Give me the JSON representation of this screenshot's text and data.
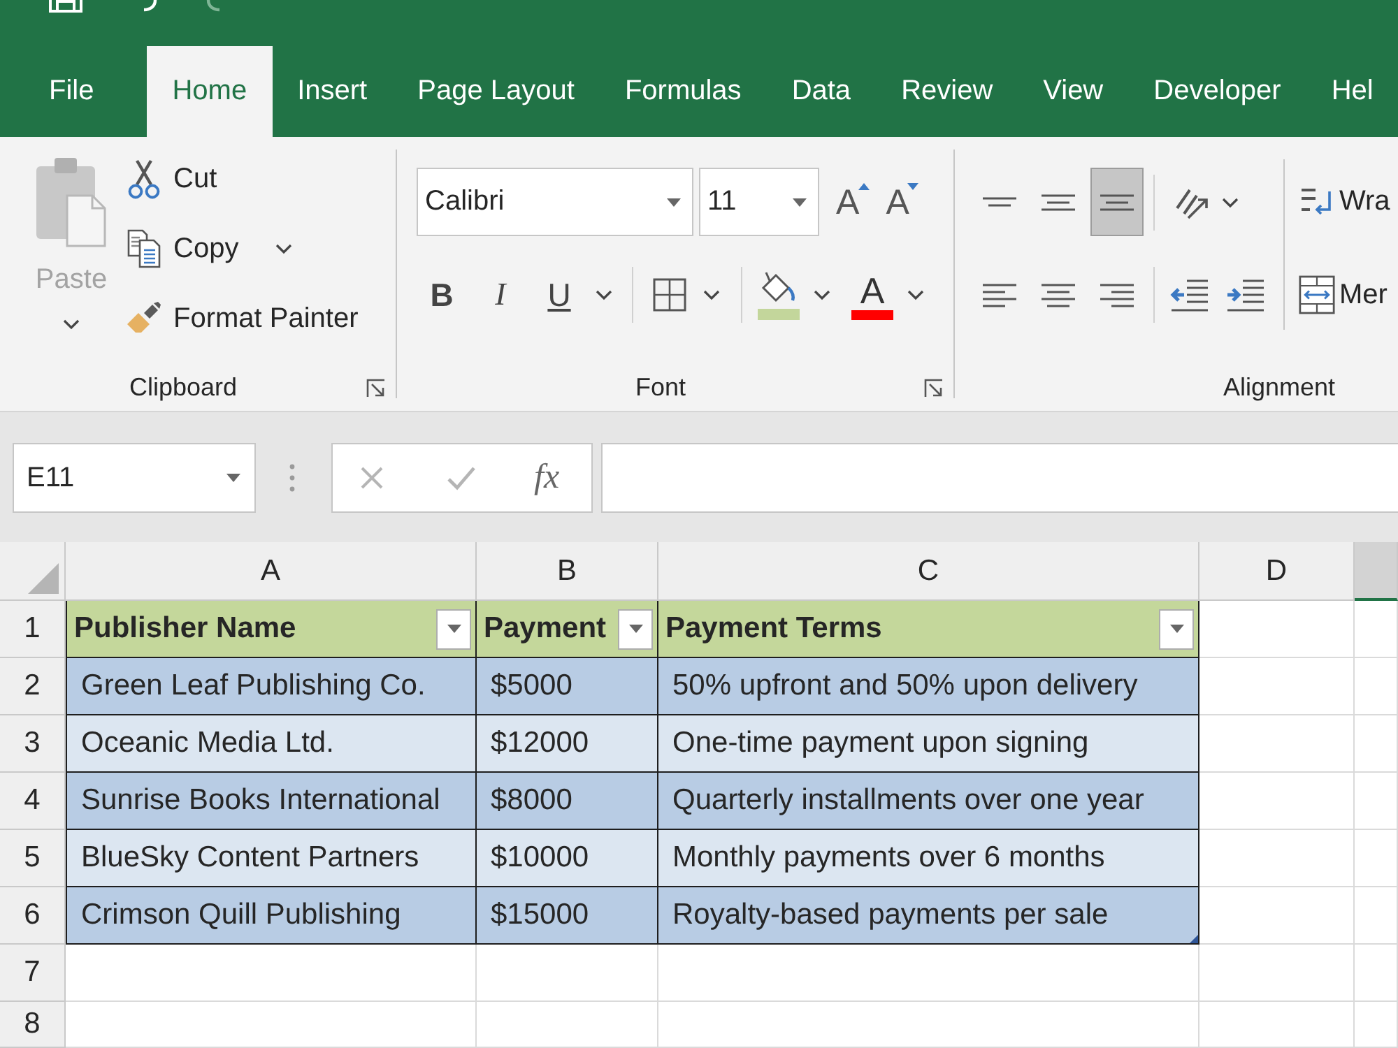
{
  "ribbon_tabs": [
    {
      "label": "File",
      "selected": false
    },
    {
      "label": "Home",
      "selected": true
    },
    {
      "label": "Insert",
      "selected": false
    },
    {
      "label": "Page Layout",
      "selected": false
    },
    {
      "label": "Formulas",
      "selected": false
    },
    {
      "label": "Data",
      "selected": false
    },
    {
      "label": "Review",
      "selected": false
    },
    {
      "label": "View",
      "selected": false
    },
    {
      "label": "Developer",
      "selected": false
    },
    {
      "label": "Hel",
      "selected": false
    }
  ],
  "clipboard": {
    "paste": {
      "label": "Paste",
      "disabled": true
    },
    "commands": [
      {
        "kind": "cut",
        "label": "Cut"
      },
      {
        "kind": "copy",
        "label": "Copy"
      },
      {
        "kind": "format_painter",
        "label": "Format Painter"
      }
    ],
    "group_label": "Clipboard"
  },
  "font": {
    "font_name": "Calibri",
    "font_size": "11",
    "grow_font": "A",
    "shrink_font": "A",
    "styles": [
      {
        "kind": "bold",
        "label": "B"
      },
      {
        "kind": "italic",
        "label": "I"
      },
      {
        "kind": "underline",
        "label": "U"
      }
    ],
    "font_color": "A",
    "group_label": "Font"
  },
  "alignment": {
    "vertical": [
      {
        "kind": "top",
        "selected": false
      },
      {
        "kind": "middle",
        "selected": false
      },
      {
        "kind": "bottom",
        "selected": true
      }
    ],
    "horizontal": [
      {
        "kind": "left",
        "selected": false
      },
      {
        "kind": "center",
        "selected": false
      },
      {
        "kind": "right",
        "selected": false
      }
    ],
    "wrap_text": "Wra",
    "merge": "Mer",
    "group_label": "Alignment"
  },
  "formula_bar": {
    "name_box": "E11",
    "function_button": "fx"
  },
  "sheet": {
    "columns": [
      {
        "label": "A",
        "selected": false
      },
      {
        "label": "B",
        "selected": false
      },
      {
        "label": "C",
        "selected": false
      },
      {
        "label": "D",
        "selected": false
      },
      {
        "selected": true
      }
    ],
    "row_numbers": [
      "1",
      "2",
      "3",
      "4",
      "5",
      "6",
      "7",
      "8"
    ],
    "table": {
      "headers": [
        "Publisher Name",
        "Payment",
        "Payment Terms"
      ],
      "rows": [
        [
          "Green Leaf Publishing Co.",
          "$5000",
          "50% upfront and 50% upon delivery"
        ],
        [
          "Oceanic Media Ltd.",
          "$12000",
          "One-time payment upon signing"
        ],
        [
          "Sunrise Books International",
          "$8000",
          "Quarterly installments over one year"
        ],
        [
          "BlueSky Content Partners",
          "$10000",
          "Monthly payments over 6 months"
        ],
        [
          "Crimson Quill Publishing",
          "$15000",
          "Royalty-based payments per sale"
        ]
      ]
    }
  }
}
